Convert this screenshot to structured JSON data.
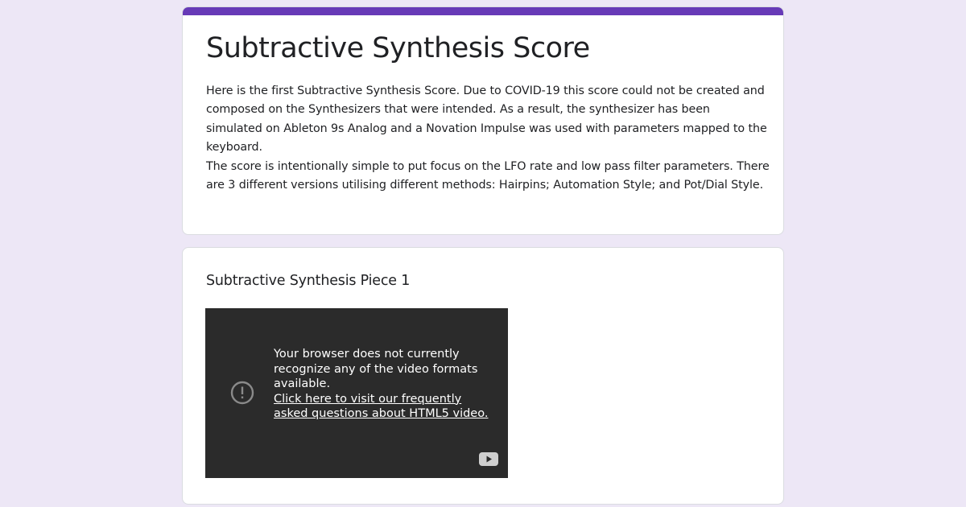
{
  "form": {
    "title": "Subtractive Synthesis Score",
    "description_1": "Here is the first Subtractive Synthesis Score. Due to COVID-19 this score could not be created and composed on the Synthesizers that were intended. As a result, the synthesizer has been simulated on Ableton 9s Analog and a Novation Impulse was used with parameters mapped to the keyboard.",
    "description_2": "The score is intentionally simple to put focus on the LFO rate and low pass filter parameters. There are 3 different versions utilising different methods: Hairpins; Automation Style; and Pot/Dial Style."
  },
  "item": {
    "title": "Subtractive Synthesis Piece 1",
    "video": {
      "message": "Your browser does not currently recognize any of the video formats available.",
      "link_text": "Click here to visit our frequently asked questions about HTML5 video.",
      "alert_icon": "error-outline-icon",
      "logo_icon": "youtube-icon"
    }
  },
  "colors": {
    "accent": "#673ab7",
    "background": "#ede7f6",
    "video_bg": "#2b2b2b"
  }
}
